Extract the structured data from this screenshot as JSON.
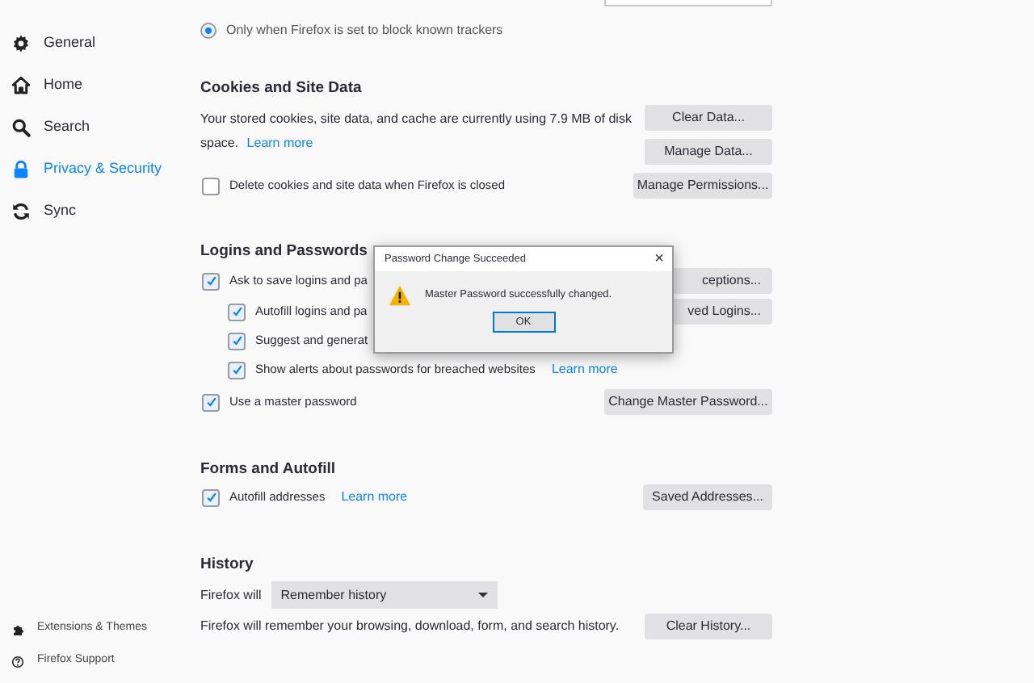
{
  "sidebar": {
    "items": [
      {
        "label": "General",
        "selected": false
      },
      {
        "label": "Home",
        "selected": false
      },
      {
        "label": "Search",
        "selected": false
      },
      {
        "label": "Privacy & Security",
        "selected": true
      },
      {
        "label": "Sync",
        "selected": false
      }
    ],
    "footer_items": [
      {
        "label": "Extensions & Themes"
      },
      {
        "label": "Firefox Support"
      }
    ]
  },
  "tracking_option": {
    "label": "Only when Firefox is set to block known trackers",
    "selected": true
  },
  "cookies": {
    "heading": "Cookies and Site Data",
    "description": "Your stored cookies, site data, and cache are currently using 7.9 MB of disk space.",
    "learn_more": "Learn more",
    "delete_on_close": {
      "label": "Delete cookies and site data when Firefox is closed",
      "checked": false
    },
    "buttons": [
      "Clear Data...",
      "Manage Data...",
      "Manage Permissions..."
    ]
  },
  "logins": {
    "heading": "Logins and Passwords",
    "ask_to_save": {
      "label": "Ask to save logins and pa",
      "checked": true,
      "button": "ceptions...",
      "children": [
        {
          "label": "Autofill logins and pa",
          "checked": true,
          "button": "ved Logins..."
        },
        {
          "label": "Suggest and generat",
          "checked": true
        },
        {
          "label": "Show alerts about passwords for breached websites",
          "checked": true,
          "learn_more": "Learn more"
        }
      ]
    },
    "master_password": {
      "label": "Use a master password",
      "checked": true,
      "button": "Change Master Password..."
    }
  },
  "forms": {
    "heading": "Forms and Autofill",
    "autofill_addresses": {
      "label": "Autofill addresses",
      "checked": true,
      "learn_more": "Learn more",
      "button": "Saved Addresses..."
    }
  },
  "history": {
    "heading": "History",
    "mode_label": "Firefox will",
    "mode_value": "Remember history",
    "description": "Firefox will remember your browsing, download, form, and search history.",
    "button": "Clear History..."
  },
  "dialog": {
    "title": "Password Change Succeeded",
    "close": "×",
    "message": "Master Password successfully changed.",
    "button": "OK"
  }
}
